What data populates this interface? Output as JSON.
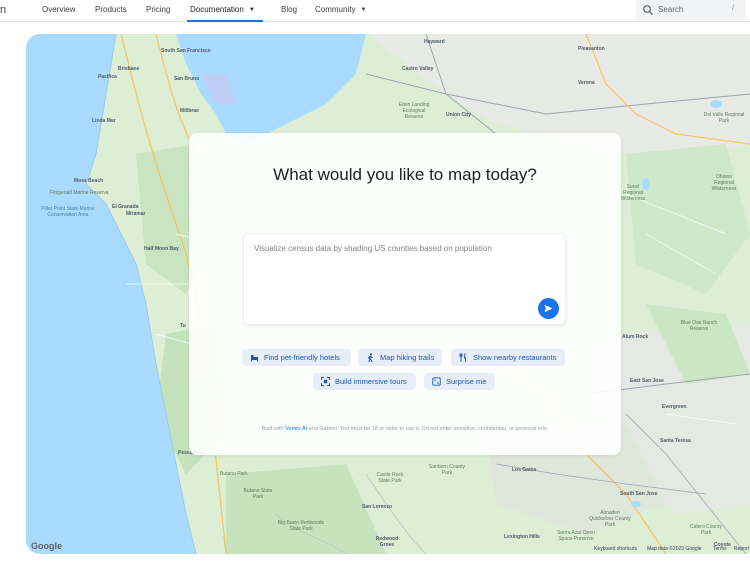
{
  "nav": {
    "edge_letter": "n",
    "items": [
      "Overview",
      "Products",
      "Pricing",
      "Documentation",
      "Blog",
      "Community"
    ],
    "active": "Documentation",
    "search_placeholder": "Search",
    "search_key": "/"
  },
  "dialog": {
    "title": "What would you like to map today?",
    "prompt_placeholder": "Visualize census data by shading US counties based on population",
    "suggestions": [
      {
        "label": "Find pet-friendly hotels",
        "icon": "hotel-icon"
      },
      {
        "label": "Map hiking trails",
        "icon": "hiking-icon"
      },
      {
        "label": "Show nearby restaurants",
        "icon": "restaurant-icon"
      },
      {
        "label": "Build immersive tours",
        "icon": "tour-icon"
      },
      {
        "label": "Surprise me",
        "icon": "surprise-icon"
      }
    ],
    "footer_prefix": "Built with ",
    "footer_link": "Vertex AI",
    "footer_suffix": " and Gemini. You must be 18 or older to use it. Do not enter sensitive, confidential, or personal info."
  },
  "map": {
    "google_logo": "Google",
    "attribution": [
      "Keyboard shortcuts",
      "Map data ©2023 Google",
      "Terms",
      "Report"
    ],
    "places": [
      {
        "name": "South San Francisco",
        "kind": "city"
      },
      {
        "name": "Brisbane",
        "kind": "city"
      },
      {
        "name": "Pacifica",
        "kind": "city"
      },
      {
        "name": "Linda Mar",
        "kind": "city"
      },
      {
        "name": "San Bruno",
        "kind": "city"
      },
      {
        "name": "Millbrae",
        "kind": "city"
      },
      {
        "name": "Moss Beach",
        "kind": "city"
      },
      {
        "name": "El Granada",
        "kind": "city"
      },
      {
        "name": "Miramar",
        "kind": "city"
      },
      {
        "name": "Fitzgerald Marine Reserve",
        "kind": "park"
      },
      {
        "name": "Pillar Point State Marine Conservation Area",
        "kind": "water"
      },
      {
        "name": "Half Moon Bay",
        "kind": "city"
      },
      {
        "name": "Tu",
        "kind": "city"
      },
      {
        "name": "Pescadero",
        "kind": "city"
      },
      {
        "name": "Butano Park",
        "kind": "park"
      },
      {
        "name": "Butano State Park",
        "kind": "park"
      },
      {
        "name": "Big Basin Redwoods State Park",
        "kind": "park"
      },
      {
        "name": "Hayward",
        "kind": "city"
      },
      {
        "name": "Castro Valley",
        "kind": "city"
      },
      {
        "name": "Eden Landing Ecological Reserve",
        "kind": "park"
      },
      {
        "name": "Union City",
        "kind": "city"
      },
      {
        "name": "Pleasanton",
        "kind": "city"
      },
      {
        "name": "Verona",
        "kind": "city"
      },
      {
        "name": "Del Valle Regional Park",
        "kind": "park"
      },
      {
        "name": "Sunol Regional Wilderness",
        "kind": "park"
      },
      {
        "name": "Ohlone Regional Wilderness",
        "kind": "park"
      },
      {
        "name": "Blue Oak Ranch Reserve",
        "kind": "park"
      },
      {
        "name": "Alum Rock",
        "kind": "city"
      },
      {
        "name": "East San Jose",
        "kind": "city"
      },
      {
        "name": "Evergreen",
        "kind": "city"
      },
      {
        "name": "South San Jose",
        "kind": "city"
      },
      {
        "name": "Santa Teresa",
        "kind": "city"
      },
      {
        "name": "Los Gatos",
        "kind": "city"
      },
      {
        "name": "Sanborn County Park",
        "kind": "park"
      },
      {
        "name": "Castle Rock State Park",
        "kind": "park"
      },
      {
        "name": "San Lorenzo",
        "kind": "city"
      },
      {
        "name": "Redwood Grove",
        "kind": "city"
      },
      {
        "name": "Lexington Hills",
        "kind": "city"
      },
      {
        "name": "Sierra Azul Open Space Preserve",
        "kind": "park"
      },
      {
        "name": "Almaden Quicksilver County Park",
        "kind": "park"
      },
      {
        "name": "Calero County Park",
        "kind": "park"
      },
      {
        "name": "Coyote",
        "kind": "city"
      }
    ]
  }
}
